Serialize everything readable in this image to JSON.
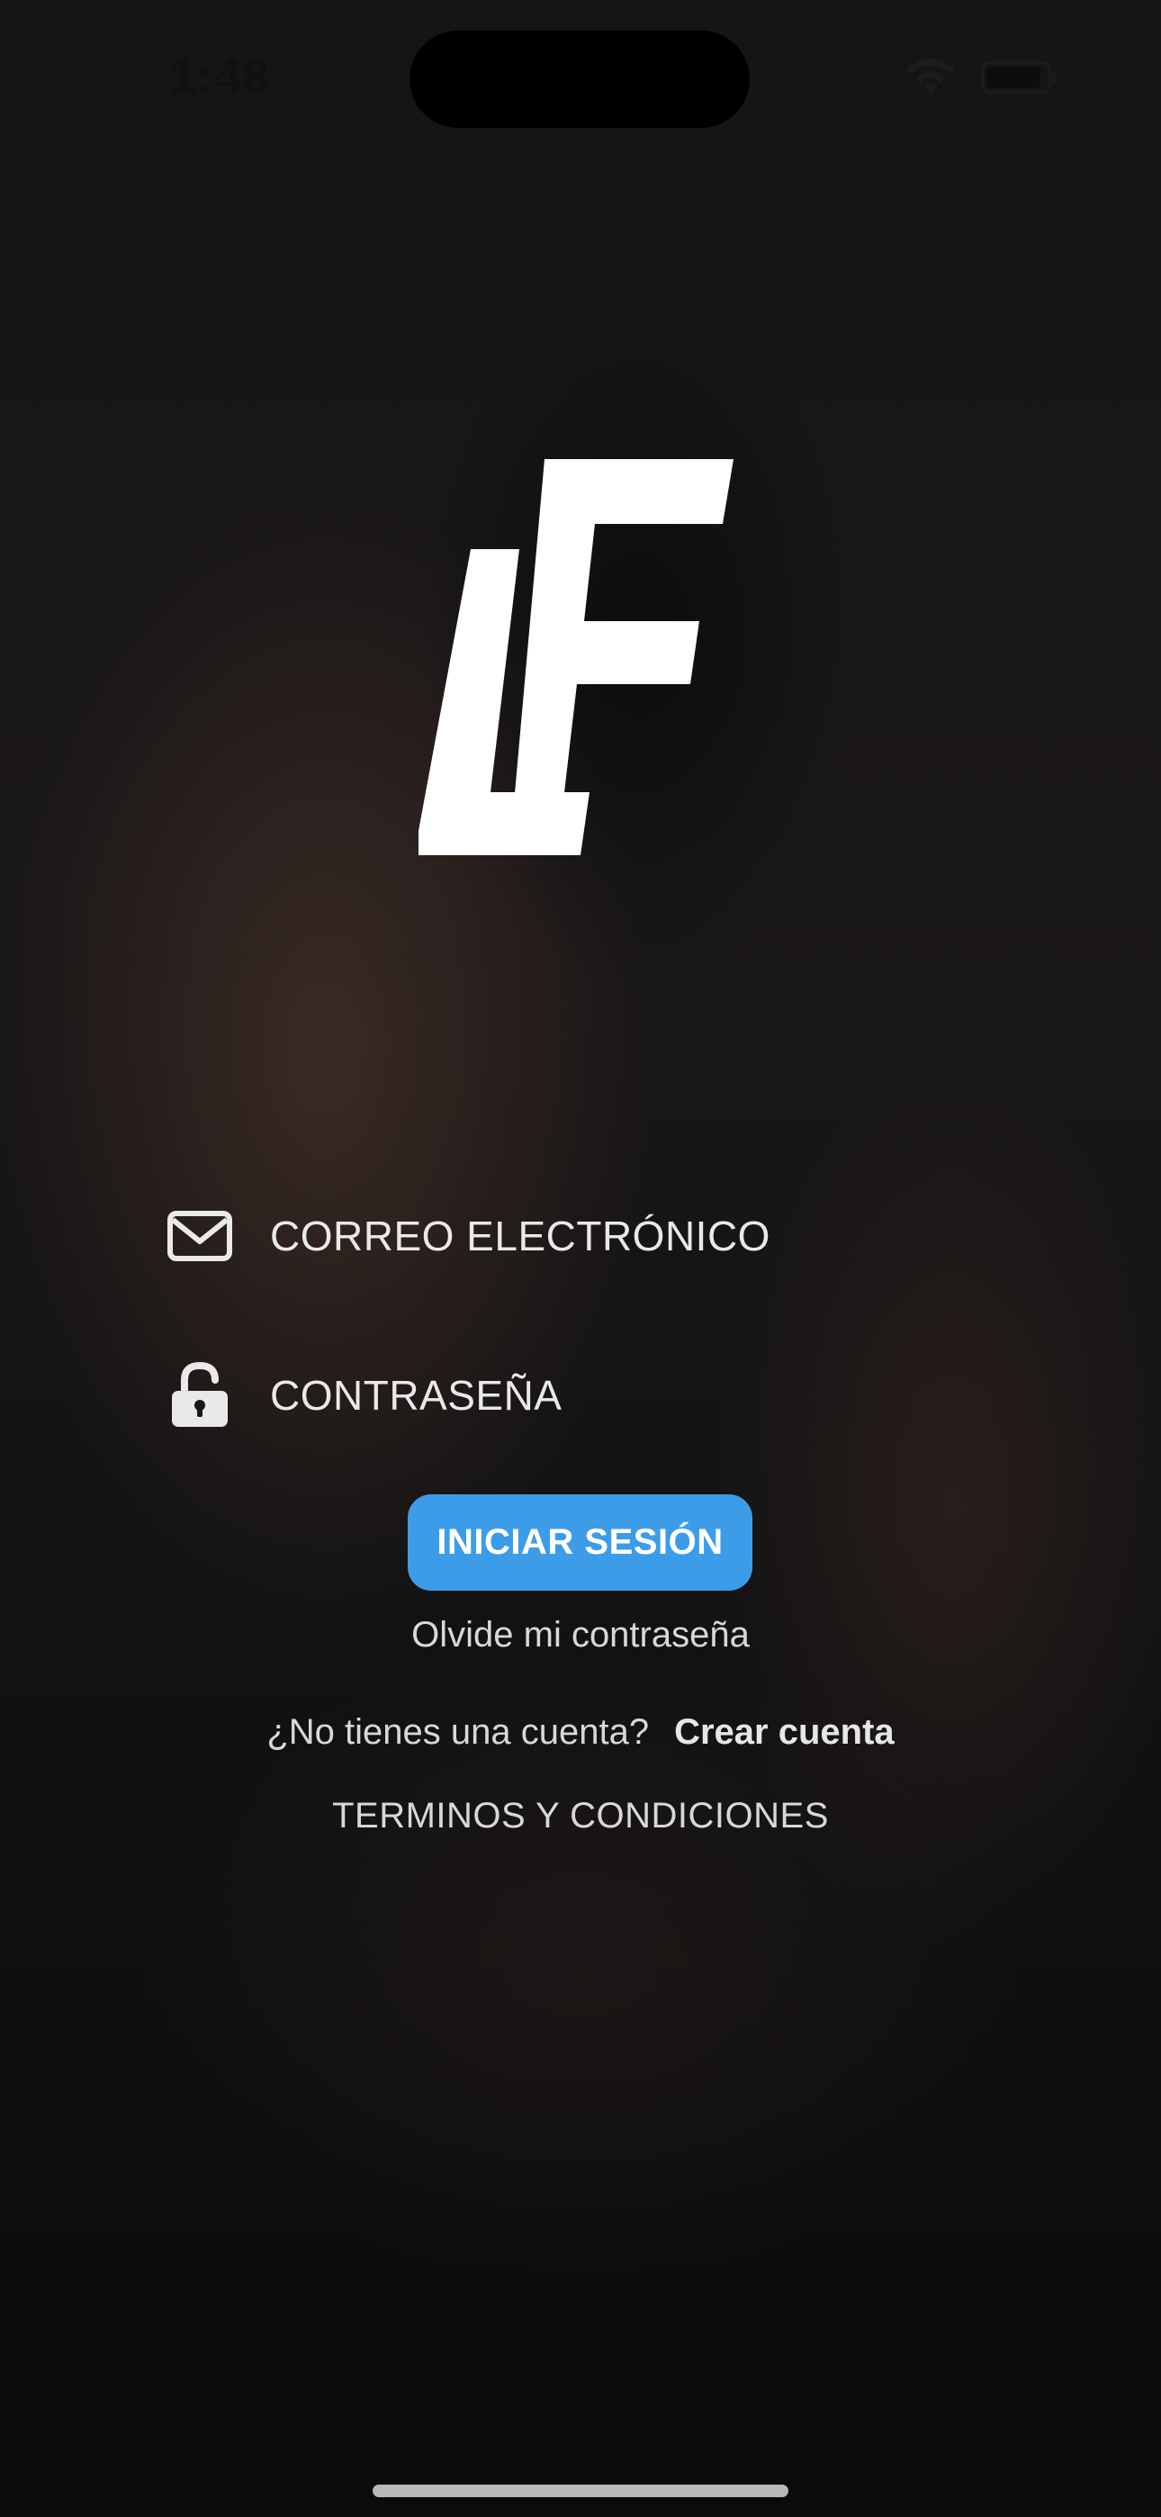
{
  "status_bar": {
    "time": "1:48"
  },
  "logo": {
    "text": "LF"
  },
  "login_form": {
    "email_label": "CORREO ELECTRÓNICO",
    "password_label": "CONTRASEÑA",
    "email_icon": "envelope-icon",
    "password_icon": "unlocked-padlock-icon"
  },
  "actions": {
    "login_button": "INICIAR SESIÓN",
    "forgot_password": "Olvide mi contraseña",
    "no_account_question": "¿No tienes una cuenta?",
    "create_account": "Crear cuenta",
    "terms": "TERMINOS Y CONDICIONES"
  },
  "colors": {
    "primary_button": "#3d9ce8",
    "text": "#e9e9ea",
    "background": "#141214"
  }
}
